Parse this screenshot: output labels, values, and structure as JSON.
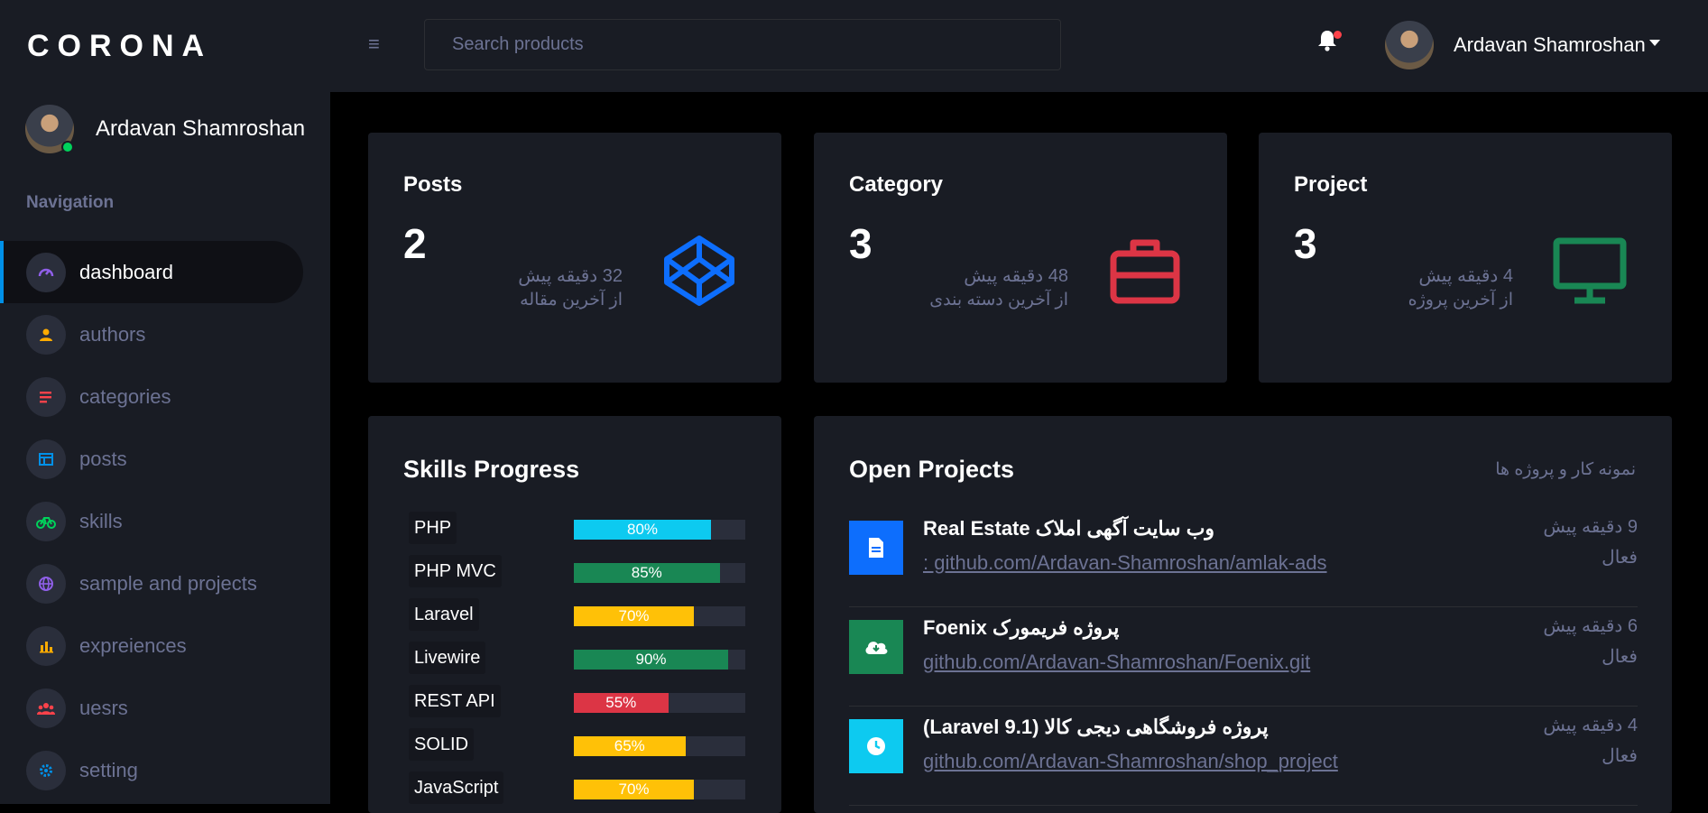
{
  "brand": "CORONA",
  "sidebar": {
    "profile_name": "Ardavan Shamroshan",
    "nav_title": "Navigation",
    "items": [
      {
        "label": "dashboard",
        "icon": "speedometer-icon",
        "color": "#8f5fe8"
      },
      {
        "label": "authors",
        "icon": "person-icon",
        "color": "#ffab00"
      },
      {
        "label": "categories",
        "icon": "list-icon",
        "color": "#fc424a"
      },
      {
        "label": "posts",
        "icon": "table-icon",
        "color": "#0090e7"
      },
      {
        "label": "skills",
        "icon": "bicycle-icon",
        "color": "#00d25b"
      },
      {
        "label": "sample and projects",
        "icon": "globe-icon",
        "color": "#8f5fe8"
      },
      {
        "label": "expreiences",
        "icon": "bar-chart-icon",
        "color": "#ffab00"
      },
      {
        "label": "uesrs",
        "icon": "users-icon",
        "color": "#fc424a"
      },
      {
        "label": "setting",
        "icon": "gear-icon",
        "color": "#0090e7"
      }
    ]
  },
  "header": {
    "search_placeholder": "Search products",
    "user_name": "Ardavan Shamroshan"
  },
  "stats": [
    {
      "title": "Posts",
      "value": "2",
      "time": "32 دقیقه پیش",
      "sub": "از آخرین مقاله",
      "icon": "codepen-icon",
      "color": "#0d6efd"
    },
    {
      "title": "Category",
      "value": "3",
      "time": "48 دقیقه پیش",
      "sub": "از آخرین دسته بندی",
      "icon": "briefcase-icon",
      "color": "#dc3545"
    },
    {
      "title": "Project",
      "value": "3",
      "time": "4 دقیقه پیش",
      "sub": "از آخرین پروژه",
      "icon": "monitor-icon",
      "color": "#198754"
    }
  ],
  "skills": {
    "title": "Skills Progress",
    "items": [
      {
        "name": "PHP",
        "percent": 80,
        "label": "80%",
        "color": "#0dcaf0"
      },
      {
        "name": "PHP MVC",
        "percent": 85,
        "label": "85%",
        "color": "#198754"
      },
      {
        "name": "Laravel",
        "percent": 70,
        "label": "70%",
        "color": "#ffc107"
      },
      {
        "name": "Livewire",
        "percent": 90,
        "label": "90%",
        "color": "#198754"
      },
      {
        "name": "REST API",
        "percent": 55,
        "label": "55%",
        "color": "#dc3545"
      },
      {
        "name": "SOLID",
        "percent": 65,
        "label": "65%",
        "color": "#ffc107"
      },
      {
        "name": "JavaScript",
        "percent": 70,
        "label": "70%",
        "color": "#ffc107"
      }
    ]
  },
  "projects": {
    "title": "Open Projects",
    "subtitle": "نمونه کار و پروژه ها",
    "items": [
      {
        "title": "Real Estate وب سایت آگهی املاک",
        "link": ": github.com/Ardavan-Shamroshan/amlak-ads",
        "time": "9 دقیقه پیش",
        "status": "فعال",
        "icon": "document-icon",
        "color": "#0d6efd"
      },
      {
        "title": "Foenix پروژه فریمورک",
        "link": "github.com/Ardavan-Shamroshan/Foenix.git",
        "time": "6 دقیقه پیش",
        "status": "فعال",
        "icon": "cloud-download-icon",
        "color": "#198754"
      },
      {
        "title": "(Laravel 9.1) پروژه فروشگاهی دیجی کالا",
        "link": "github.com/Ardavan-Shamroshan/shop_project",
        "time": "4 دقیقه پیش",
        "status": "فعال",
        "icon": "clock-icon",
        "color": "#0dcaf0"
      }
    ]
  }
}
